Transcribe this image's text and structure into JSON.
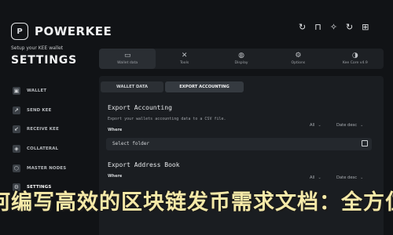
{
  "brand": {
    "name": "POWERKEE",
    "logo_glyph": "P"
  },
  "sidebar": {
    "subtitle": "Setup your KEE wallet",
    "title": "SETTINGS",
    "items": [
      {
        "label": "WALLET",
        "icon": "wallet-icon"
      },
      {
        "label": "SEND KEE",
        "icon": "send-icon"
      },
      {
        "label": "RECEIVE KEE",
        "icon": "receive-icon"
      },
      {
        "label": "COLLATERAL",
        "icon": "collateral-icon"
      },
      {
        "label": "MASTER NODES",
        "icon": "nodes-icon"
      },
      {
        "label": "SETTINGS",
        "icon": "gear-icon"
      }
    ]
  },
  "topbar": {
    "icons": [
      "refresh-icon",
      "lock-icon",
      "network-icon",
      "sync-icon",
      "info-icon"
    ],
    "glyphs": [
      "↻",
      "⊓",
      "✧",
      "↻",
      "⊞"
    ]
  },
  "tabs": [
    {
      "label": "Wallet data",
      "glyph": "▭"
    },
    {
      "label": "Tools",
      "glyph": "✕"
    },
    {
      "label": "Display",
      "glyph": "◍"
    },
    {
      "label": "Options",
      "glyph": "⚙"
    },
    {
      "label": "Kee Core v4.9",
      "glyph": "◑"
    }
  ],
  "subtabs": [
    "WALLET DATA",
    "EXPORT ACCOUNTING"
  ],
  "export_accounting": {
    "title": "Export Accounting",
    "description": "Export your wallets accounting data to a CSV file.",
    "where_label": "Where",
    "filter": "All",
    "sort": "Date desc",
    "field_value": "Select folder"
  },
  "export_address_book": {
    "title": "Export Address Book",
    "where_label": "Where",
    "filter": "All",
    "sort": "Date desc"
  },
  "overlay_text": "何编写高效的区块链发币需求文档：全方位指"
}
